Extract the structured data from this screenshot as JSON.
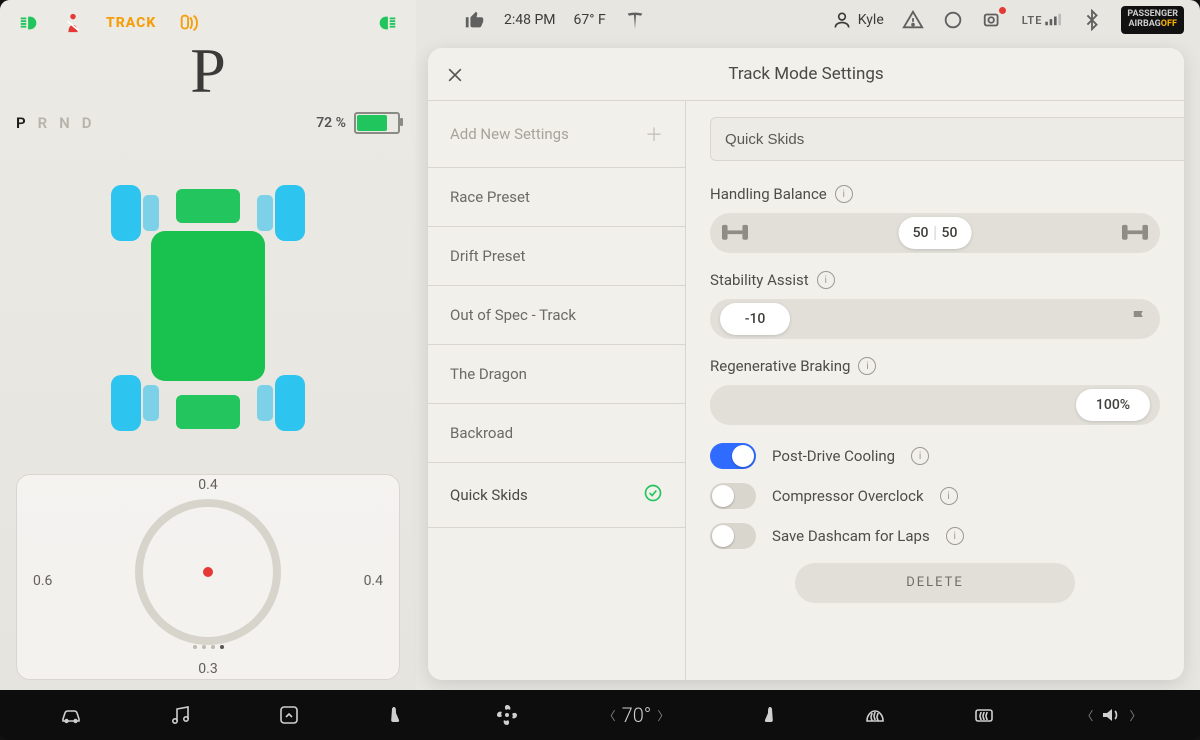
{
  "domain": "Computer-Use",
  "status": {
    "time": "2:48 PM",
    "outside_temp": "67° F",
    "user": "Kyle",
    "signal_label": "LTE",
    "airbag_line1": "PASSENGER",
    "airbag_line2": "AIRBAG",
    "airbag_off": "OFF"
  },
  "dash": {
    "icons": {
      "track_label": "TRACK"
    },
    "gear": "P",
    "prnd": [
      "P",
      "R",
      "N",
      "D"
    ],
    "battery_pct": "72 %",
    "g": {
      "top": "0.4",
      "left": "0.6",
      "right": "0.4",
      "bottom": "0.3"
    }
  },
  "modal": {
    "title": "Track Mode Settings",
    "presets": [
      {
        "label": "Add New Settings",
        "add": true
      },
      {
        "label": "Race Preset"
      },
      {
        "label": "Drift Preset"
      },
      {
        "label": "Out of Spec - Track"
      },
      {
        "label": "The Dragon"
      },
      {
        "label": "Backroad"
      },
      {
        "label": "Quick Skids",
        "selected": true
      }
    ],
    "name_value": "Quick Skids",
    "handling": {
      "label": "Handling Balance",
      "front": "50",
      "rear": "50"
    },
    "stability": {
      "label": "Stability Assist",
      "value": "-10"
    },
    "regen": {
      "label": "Regenerative Braking",
      "value": "100%"
    },
    "toggles": {
      "cooling": {
        "label": "Post-Drive Cooling",
        "on": true
      },
      "compressor": {
        "label": "Compressor Overclock",
        "on": false
      },
      "dashcam": {
        "label": "Save Dashcam for Laps",
        "on": false
      }
    },
    "delete_label": "DELETE"
  },
  "dock": {
    "cabin_temp": "70°"
  }
}
